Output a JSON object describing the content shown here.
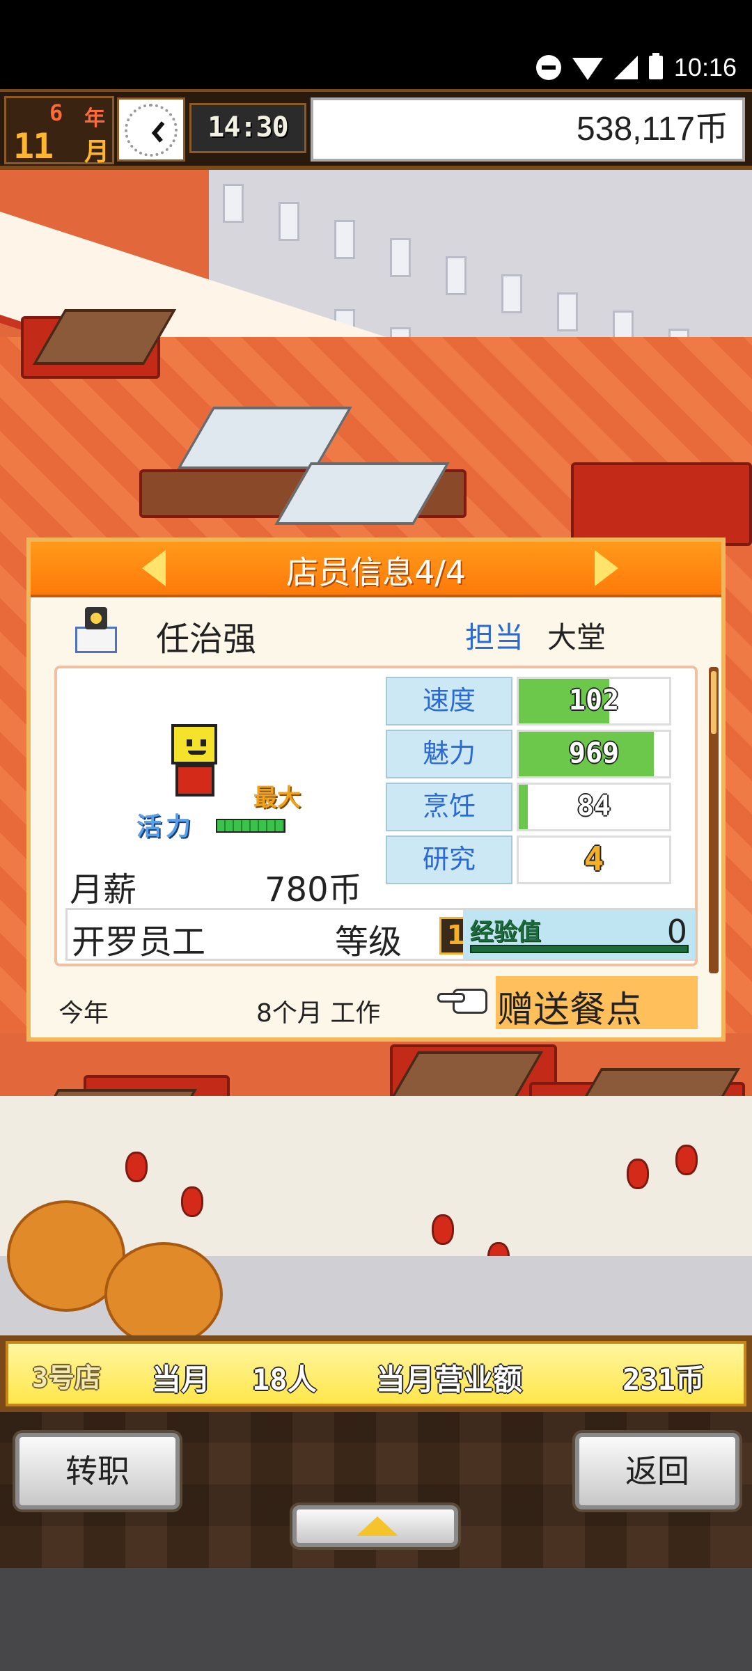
{
  "status_bar": {
    "time": "10:16"
  },
  "header": {
    "year_number": "6",
    "year_label": "年",
    "month_number": "11",
    "month_label": "月",
    "clock_time": "14:30",
    "money": "538,117币"
  },
  "dialog": {
    "title": "店员信息4/4",
    "staff_name": "任治强",
    "dept_label": "担当",
    "dept_value": "大堂",
    "max_label": "最大",
    "stamina_label": "活力",
    "stamina_level": 1.0,
    "salary_label": "月薪",
    "salary_value": "780币",
    "stats": [
      {
        "label": "速度",
        "value": "102",
        "fill": 0.6
      },
      {
        "label": "魅力",
        "value": "969",
        "fill": 0.9
      },
      {
        "label": "烹饪",
        "value": "84",
        "fill": 0.06
      },
      {
        "label": "研究",
        "value": "4",
        "fill": 0
      }
    ],
    "job": "开罗员工",
    "level_label": "等级",
    "level_value": "1",
    "exp_label": "经验值",
    "exp_value": "0",
    "footer_year": "今年",
    "footer_months": "8个月 工作",
    "gift_button": "赠送餐点"
  },
  "store_bar": {
    "store": "3号店",
    "month_label": "当月",
    "customers": "18人",
    "sales_label": "当月营业额",
    "sales_value": "231币"
  },
  "controls": {
    "transfer": "转职",
    "back": "返回"
  },
  "colors": {
    "dialog_header": "#ff8a10",
    "stat_fill": "#6cc84a",
    "money_bg": "#ffffff"
  }
}
